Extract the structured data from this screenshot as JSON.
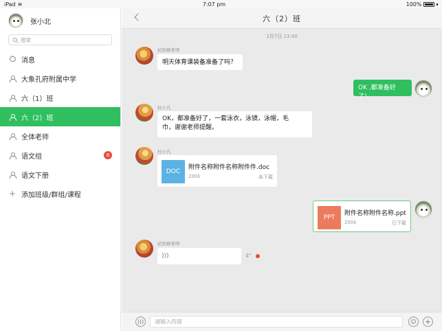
{
  "status_bar": {
    "device": "iPad",
    "time": "7:07 pm",
    "battery": "100%"
  },
  "sidebar": {
    "user_name": "张小北",
    "search_placeholder": "搜索",
    "items": [
      {
        "label": "消息",
        "icon": "chat-bubble-icon"
      },
      {
        "label": "大象孔府附属中学",
        "icon": "person-icon"
      },
      {
        "label": "六（1）班",
        "icon": "person-icon"
      },
      {
        "label": "六（2）班",
        "icon": "person-icon",
        "active": true
      },
      {
        "label": "全体老师",
        "icon": "person-icon"
      },
      {
        "label": "语文组",
        "icon": "person-icon",
        "badge": "8"
      },
      {
        "label": "语文下册",
        "icon": "person-icon"
      },
      {
        "label": "添加班级/群组/课程",
        "icon": "plus-icon"
      }
    ]
  },
  "chat": {
    "title": "六（2）班",
    "timestamp": "2月7日 13:40",
    "messages": [
      {
        "sender": "纪凯静老师",
        "text": "明天体育课装备准备了吗？"
      },
      {
        "sender": "",
        "text": "OK ,都准备好了！"
      },
      {
        "sender": "杜小凡",
        "text_line1": "OK，都准备好了，一套泳衣，泳镜，泳帽，毛",
        "text_line2": "巾，谢谢老师提醒。"
      },
      {
        "sender": "杜小凡",
        "file": {
          "type": "DOC",
          "name": "附件名称附件名称附件件.doc",
          "size": "200k",
          "status": "未下载",
          "color": "#5ab3e4"
        }
      },
      {
        "sender": "",
        "file": {
          "type": "PPT",
          "name": "附件名称附件名称.ppt",
          "size": "200k",
          "status": "已下载",
          "color": "#ec7b5d"
        }
      },
      {
        "sender": "纪凯静老师",
        "voice": {
          "duration": "4\""
        }
      }
    ],
    "input_placeholder": "请输入内容"
  },
  "colors": {
    "accent": "#2fbf5f",
    "badge": "#e74c3c",
    "chat_bg": "#eaeaea"
  }
}
